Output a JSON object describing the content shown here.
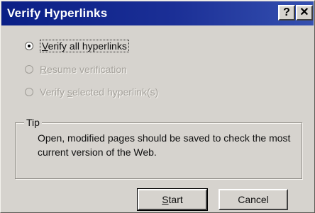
{
  "window": {
    "title": "Verify Hyperlinks",
    "help_button": "?",
    "close_button": "✕"
  },
  "options": [
    {
      "pre": "",
      "mnemonic": "V",
      "rest": "erify all hyperlinks",
      "selected": true,
      "enabled": true
    },
    {
      "pre": "",
      "mnemonic": "R",
      "rest": "esume verification",
      "selected": false,
      "enabled": false
    },
    {
      "pre": "Verify ",
      "mnemonic": "s",
      "rest": "elected hyperlink(s)",
      "selected": false,
      "enabled": false
    }
  ],
  "tip": {
    "label": "Tip",
    "text": "Open, modified pages should be saved to check the most current version of the Web."
  },
  "buttons": {
    "start_mnemonic": "S",
    "start_rest": "tart",
    "cancel": "Cancel"
  },
  "colors": {
    "titlebar": "#0a1f86",
    "dialog_face": "#d6d3ce",
    "disabled_text": "#a5a29c"
  }
}
